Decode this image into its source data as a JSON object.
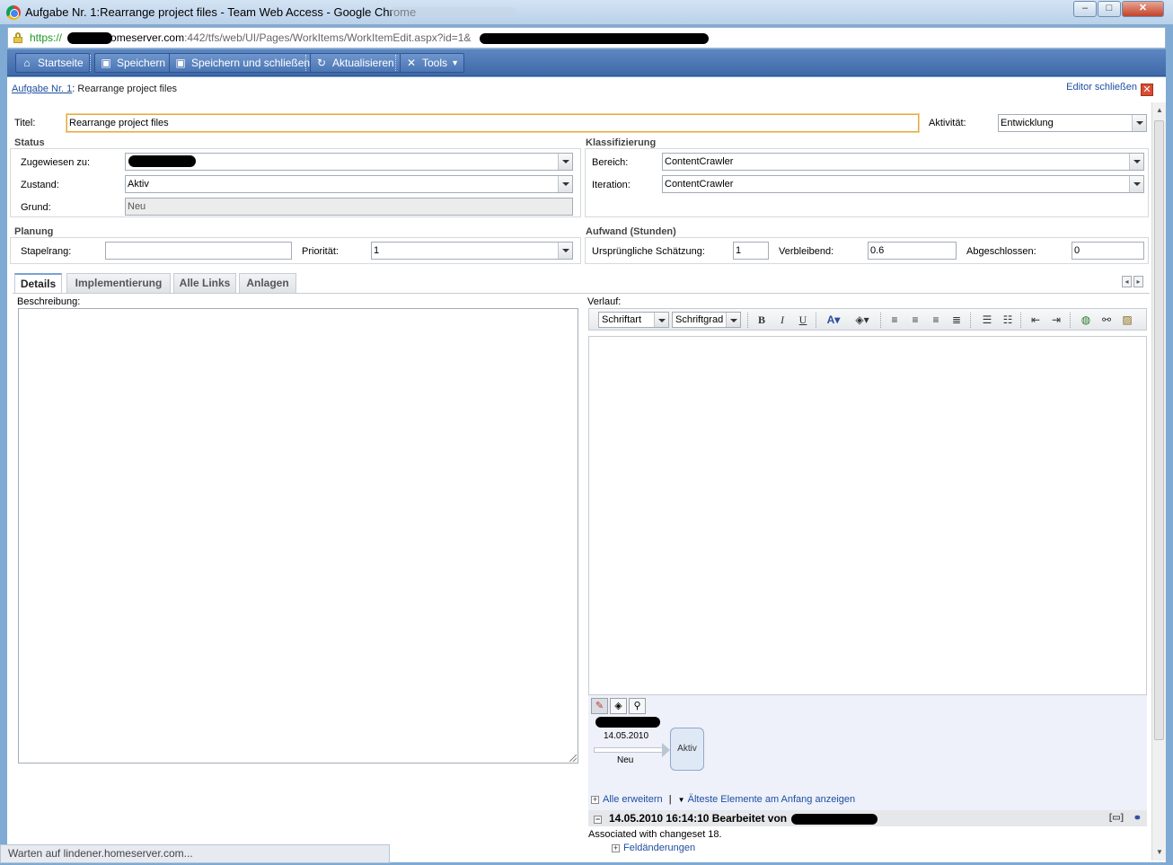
{
  "window": {
    "title": "Aufgabe Nr. 1:Rearrange project files - Team Web Access - Google Chrome",
    "minimize": "‒",
    "maximize": "□",
    "close": "✕"
  },
  "address": {
    "scheme": "https://",
    "host": ".homeserver.com",
    "path": ":442/tfs/web/UI/Pages/WorkItems/WorkItemEdit.aspx?id=1&"
  },
  "toolbar": {
    "home": "Startseite",
    "save": "Speichern",
    "save_close": "Speichern und schließen",
    "refresh": "Aktualisieren",
    "tools": "Tools"
  },
  "breadcrumb": {
    "link": "Aufgabe Nr. 1",
    "rest": ": Rearrange project files"
  },
  "close_editor": "Editor schließen",
  "form": {
    "title_label": "Titel:",
    "title_value": "Rearrange project files",
    "activity_label": "Aktivität:",
    "activity_value": "Entwicklung"
  },
  "status": {
    "heading": "Status",
    "assigned_label": "Zugewiesen zu:",
    "state_label": "Zustand:",
    "state_value": "Aktiv",
    "reason_label": "Grund:",
    "reason_value": "Neu"
  },
  "classification": {
    "heading": "Klassifizierung",
    "area_label": "Bereich:",
    "area_value": "ContentCrawler",
    "iteration_label": "Iteration:",
    "iteration_value": "ContentCrawler"
  },
  "planning": {
    "heading": "Planung",
    "stack_rank_label": "Stapelrang:",
    "stack_rank_value": "",
    "priority_label": "Priorität:",
    "priority_value": "1"
  },
  "effort": {
    "heading": "Aufwand (Stunden)",
    "original_label": "Ursprüngliche Schätzung:",
    "original_value": "1",
    "remaining_label": "Verbleibend:",
    "remaining_value": "0.6",
    "completed_label": "Abgeschlossen:",
    "completed_value": "0"
  },
  "tabs": [
    "Details",
    "Implementierung",
    "Alle Links",
    "Anlagen"
  ],
  "details": {
    "description_label": "Beschreibung:",
    "history_label": "Verlauf:"
  },
  "rte": {
    "font": "Schriftart",
    "size": "Schriftgrad"
  },
  "history": {
    "date": "14.05.2010",
    "from_state": "Neu",
    "to_state": "Aktiv",
    "expand_all": "Alle erweitern",
    "separator": "|",
    "oldest_first": "Älteste Elemente am Anfang anzeigen",
    "revision_header": "14.05.2010 16:14:10 Bearbeitet von",
    "revision_text": "Associated with changeset 18.",
    "field_changes": "Feldänderungen"
  },
  "statusbar": "Warten auf lindener.homeserver.com..."
}
